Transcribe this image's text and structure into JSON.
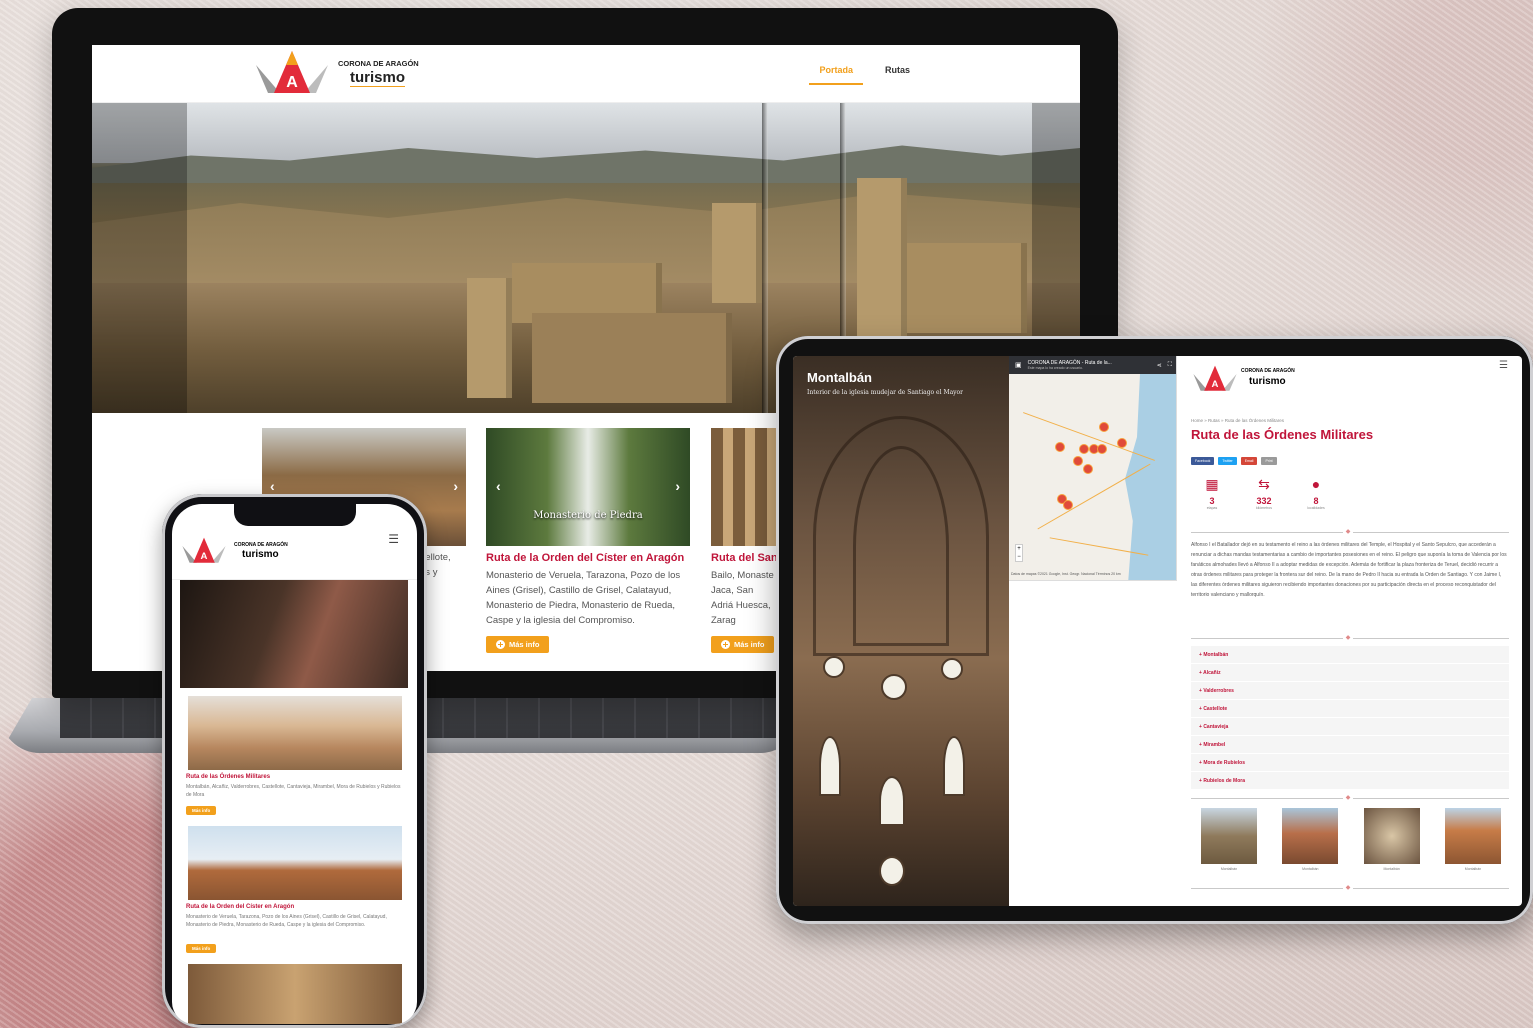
{
  "laptop": {
    "logo": {
      "line1": "CORONA DE ARAGÓN",
      "line2": "turismo"
    },
    "nav": [
      {
        "label": "Portada",
        "active": true
      },
      {
        "label": "Rutas",
        "active": false
      }
    ],
    "cards": [
      {
        "title": "",
        "desc": "...stellote, ...los y",
        "button": ""
      },
      {
        "title": "Ruta de la Orden del Císter en Aragón",
        "img_caption": "Monasterio de Piedra",
        "desc": "Monasterio de Veruela, Tarazona, Pozo de los Aines (Grisel), Castillo de Grisel, Calatayud, Monasterio de Piedra, Monasterio de Rueda, Caspe y la iglesia del Compromiso.",
        "button": "Más info"
      },
      {
        "title": "Ruta del San",
        "desc": "Bailo, Monaste Jaca, San Adriá Huesca, Zarag",
        "button": "Más info"
      }
    ],
    "arrows": {
      "prev": "‹",
      "next": "›"
    }
  },
  "phone": {
    "logo": {
      "line1": "CORONA DE ARAGÓN",
      "line2": "turismo"
    },
    "menu_icon": "☰",
    "items": [
      {
        "title": "Ruta de las Órdenes Militares",
        "desc": "Montalbán, Alcañiz, Valderrobres, Castellote, Cantavieja, Mirambel, Mora de Rubielos y Rubielos de Mora",
        "button": "Más info"
      },
      {
        "title": "Ruta de la Orden del Císter en Aragón",
        "desc": "Monasterio de Veruela, Tarazona, Pozo de los Aines (Grisel), Castillo de Grisel, Calatayud, Monasterio de Piedra, Monasterio de Rueda, Caspe y la iglesia del Compromiso.",
        "button": "Más info"
      }
    ]
  },
  "tablet": {
    "photo": {
      "title": "Montalbán",
      "subtitle": "Interior de la iglesia mudejar de Santiago el Mayor"
    },
    "map": {
      "bar_title": "CORONA DE ARAGÓN - Ruta de la...",
      "bar_sub": "Este mapa lo ha creado un usuario.",
      "footer": "Datos de mapas ©2021 Google, Inst. Geogr. Nacional   Términos   20 km"
    },
    "logo": {
      "line1": "CORONA DE ARAGÓN",
      "line2": "turismo"
    },
    "menu_icon": "☰",
    "breadcrumb": "Home » Rutas » Ruta de las Órdenes Militares",
    "title": "Ruta de las Órdenes Militares",
    "share": [
      {
        "label": "Facebook",
        "color": "#3b5998"
      },
      {
        "label": "Twitter",
        "color": "#1da1f2"
      },
      {
        "label": "Email",
        "color": "#d44638"
      },
      {
        "label": "Print",
        "color": "#9a9a9a"
      }
    ],
    "stats": [
      {
        "icon": "calendar-icon",
        "glyph": "🗓",
        "num": "3",
        "label": "etapas"
      },
      {
        "icon": "signpost-icon",
        "glyph": "⇆",
        "num": "332",
        "label": "kilómetros"
      },
      {
        "icon": "pin-icon",
        "glyph": "📍",
        "num": "8",
        "label": "localidades"
      }
    ],
    "body": "Alfonso I el Batallador dejó en su testamento el reino a las órdenes militares del Temple, el Hospital y el Santo Sepulcro, que accederán a renunciar a dichas mandas testamentarias a cambio de importantes posesiones en el reino. El peligro que suponía la toma de Valencia por los fanáticos almohades llevó a Alfonso II a adoptar medidas de excepción. Además de fortificar la plaza fronteriza de Teruel, decidió recurrir a otras órdenes militares para proteger la frontera sur del reino. De la mano de Pedro II hacia su entrada la Orden de Santiago. Y con Jaime I, las diferentes órdenes militares siguieron recibiendo importantes donaciones por su participación directa en el proceso reconquistador del territorio valenciano y mallorquín.",
    "accordion": [
      "Montalbán",
      "Alcañiz",
      "Valderrobres",
      "Castellote",
      "Cantavieja",
      "Mirambel",
      "Mora de Rubielos",
      "Rubielos de Mora"
    ],
    "thumbs": [
      "Montalbán",
      "Montalbán",
      "Montalbán",
      "Montalbán"
    ]
  },
  "colors": {
    "accent": "#f2a01c",
    "brand": "#c0153a"
  }
}
